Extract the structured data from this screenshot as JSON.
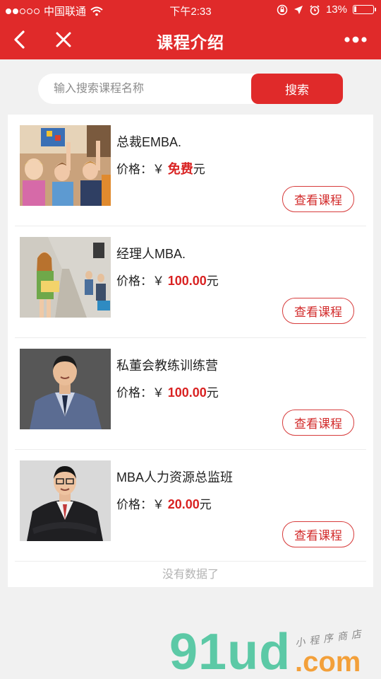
{
  "status_bar": {
    "carrier": "中国联通",
    "time": "下午2:33",
    "battery": "13%",
    "battery_level": 0.13
  },
  "nav": {
    "title": "课程介绍"
  },
  "search": {
    "placeholder": "输入搜索课程名称",
    "button": "搜索"
  },
  "courses": [
    {
      "name": "总裁EMBA.",
      "price_label": "价格：",
      "currency": "￥",
      "price": "免费",
      "unit": "元",
      "button": "查看课程"
    },
    {
      "name": "经理人MBA.",
      "price_label": "价格：",
      "currency": "￥",
      "price": "100.00",
      "unit": "元",
      "button": "查看课程"
    },
    {
      "name": "私董会教练训练营",
      "price_label": "价格：",
      "currency": "￥",
      "price": "100.00",
      "unit": "元",
      "button": "查看课程"
    },
    {
      "name": "MBA人力资源总监班",
      "price_label": "价格：",
      "currency": "￥",
      "price": "20.00",
      "unit": "元",
      "button": "查看课程"
    }
  ],
  "list_end": "没有数据了",
  "watermark": {
    "text": "91ud",
    "domain": ".com",
    "tagline": "小程序商店"
  },
  "colors": {
    "brand_red": "#e02a2a",
    "price_red": "#d92222",
    "watermark_green": "#5cc9a6",
    "watermark_orange": "#f3a03a"
  }
}
